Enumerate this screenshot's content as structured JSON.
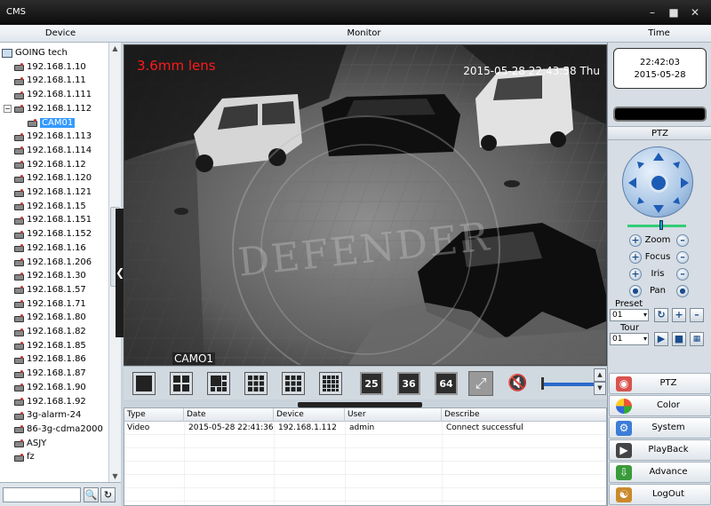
{
  "window": {
    "title": "CMS"
  },
  "columns": {
    "device": "Device",
    "monitor": "Monitor",
    "time": "Time"
  },
  "tree": {
    "root": "GOING tech",
    "items": [
      {
        "label": "192.168.1.10",
        "level": 1
      },
      {
        "label": "192.168.1.11",
        "level": 1
      },
      {
        "label": "192.168.1.111",
        "level": 1
      },
      {
        "label": "192.168.1.112",
        "level": 1,
        "expanded": true
      },
      {
        "label": "CAM01",
        "level": 2,
        "selected": true
      },
      {
        "label": "192.168.1.113",
        "level": 1
      },
      {
        "label": "192.168.1.114",
        "level": 1
      },
      {
        "label": "192.168.1.12",
        "level": 1
      },
      {
        "label": "192.168.1.120",
        "level": 1
      },
      {
        "label": "192.168.1.121",
        "level": 1
      },
      {
        "label": "192.168.1.15",
        "level": 1
      },
      {
        "label": "192.168.1.151",
        "level": 1
      },
      {
        "label": "192.168.1.152",
        "level": 1
      },
      {
        "label": "192.168.1.16",
        "level": 1
      },
      {
        "label": "192.168.1.206",
        "level": 1
      },
      {
        "label": "192.168.1.30",
        "level": 1
      },
      {
        "label": "192.168.1.57",
        "level": 1
      },
      {
        "label": "192.168.1.71",
        "level": 1
      },
      {
        "label": "192.168.1.80",
        "level": 1
      },
      {
        "label": "192.168.1.82",
        "level": 1
      },
      {
        "label": "192.168.1.85",
        "level": 1
      },
      {
        "label": "192.168.1.86",
        "level": 1
      },
      {
        "label": "192.168.1.87",
        "level": 1
      },
      {
        "label": "192.168.1.90",
        "level": 1
      },
      {
        "label": "192.168.1.92",
        "level": 1
      },
      {
        "label": "3g-alarm-24",
        "level": 1
      },
      {
        "label": "86-3g-cdma2000",
        "level": 1
      },
      {
        "label": "ASJY",
        "level": 1
      },
      {
        "label": "fz",
        "level": 1
      }
    ]
  },
  "search": {
    "value": "",
    "placeholder": ""
  },
  "video": {
    "lens_text": "3.6mm lens",
    "osd_datetime": "2015-05-28 22:43:58 Thu",
    "camera_label": "CAMO1",
    "watermark": "DEFENDER"
  },
  "layout_buttons": [
    "1",
    "4",
    "6",
    "8",
    "9",
    "16",
    "25",
    "36",
    "64"
  ],
  "log": {
    "headers": [
      "Type",
      "Date",
      "Device",
      "User",
      "Describe"
    ],
    "rows": [
      {
        "type": "Video",
        "date": "2015-05-28 22:41:36",
        "device": "192.168.1.112",
        "user": "admin",
        "describe": "Connect successful"
      }
    ]
  },
  "clock": {
    "time": "22:42:03",
    "date": "2015-05-28"
  },
  "ptz": {
    "header": "PTZ",
    "controls": [
      "Zoom",
      "Focus",
      "Iris",
      "Pan"
    ],
    "preset_label": "Preset",
    "preset_value": "01",
    "tour_label": "Tour",
    "tour_value": "01"
  },
  "menu": [
    {
      "label": "PTZ",
      "icon": "ptz-icon",
      "color": "#d9534f"
    },
    {
      "label": "Color",
      "icon": "color-icon",
      "color": "#f0a030"
    },
    {
      "label": "System",
      "icon": "system-icon",
      "color": "#3b7dd8"
    },
    {
      "label": "PlayBack",
      "icon": "playback-icon",
      "color": "#444444"
    },
    {
      "label": "Advance",
      "icon": "advance-icon",
      "color": "#3a9b3a"
    },
    {
      "label": "LogOut",
      "icon": "logout-icon",
      "color": "#c98a2c"
    }
  ],
  "colors": {
    "accent": "#3399ff",
    "lens_text": "#ff1a1a",
    "titlebar": "#1a1a1a"
  }
}
